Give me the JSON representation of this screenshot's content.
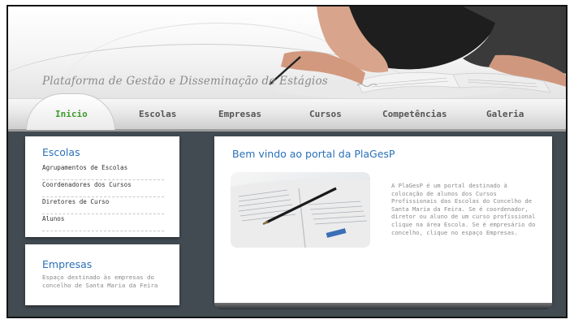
{
  "header": {
    "title": "Plataforma de Gestão e Disseminação de Estágios"
  },
  "nav": {
    "items": [
      {
        "label": "Inicio"
      },
      {
        "label": "Escolas"
      },
      {
        "label": "Empresas"
      },
      {
        "label": "Cursos"
      },
      {
        "label": "Competências"
      },
      {
        "label": "Galeria"
      }
    ],
    "active_color": "#3d9b2c"
  },
  "sidebar": {
    "escolas": {
      "heading": "Escolas",
      "items": [
        {
          "label": "Agrupamentos de Escolas"
        },
        {
          "label": "Coordenadores dos Cursos"
        },
        {
          "label": "Diretores de Curso"
        },
        {
          "label": "Alunos"
        }
      ]
    },
    "empresas": {
      "heading": "Empresas",
      "description": "Espaço destinado às empresas do concelho de Santa Maria da Feira"
    }
  },
  "main": {
    "heading": "Bem vindo ao portal da PlaGesP",
    "body": "A PlaGesP é um portal destinado à colocação de alunos dos Cursos Profissionais das Escolas do Concelho de Santa Maria da Feira. Se é coordenador, diretor ou aluno de um curso profissional clique na área Escola. Se é empresário do concelho, clique no espaço Empresas."
  },
  "colors": {
    "heading_blue": "#2a70b8",
    "frame_bg": "#424b52"
  }
}
